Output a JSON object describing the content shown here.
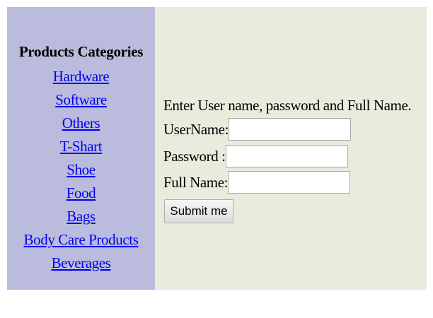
{
  "sidebar": {
    "title": "Products Categories",
    "categories": [
      "Hardware",
      "Software",
      "Others",
      "T-Shart",
      "Shoe",
      "Food",
      "Bags",
      "Body Care Products",
      "Beverages"
    ]
  },
  "form": {
    "intro": "Enter User name, password and Full Name.",
    "username_label": "UserName:",
    "username_value": "",
    "password_label": "Password :",
    "password_value": "",
    "fullname_label": "Full Name:",
    "fullname_value": "",
    "submit_label": "Submit me"
  },
  "colors": {
    "sidebar_bg": "#bbbbdd",
    "main_bg": "#ebebdd",
    "link": "#0000ee"
  }
}
